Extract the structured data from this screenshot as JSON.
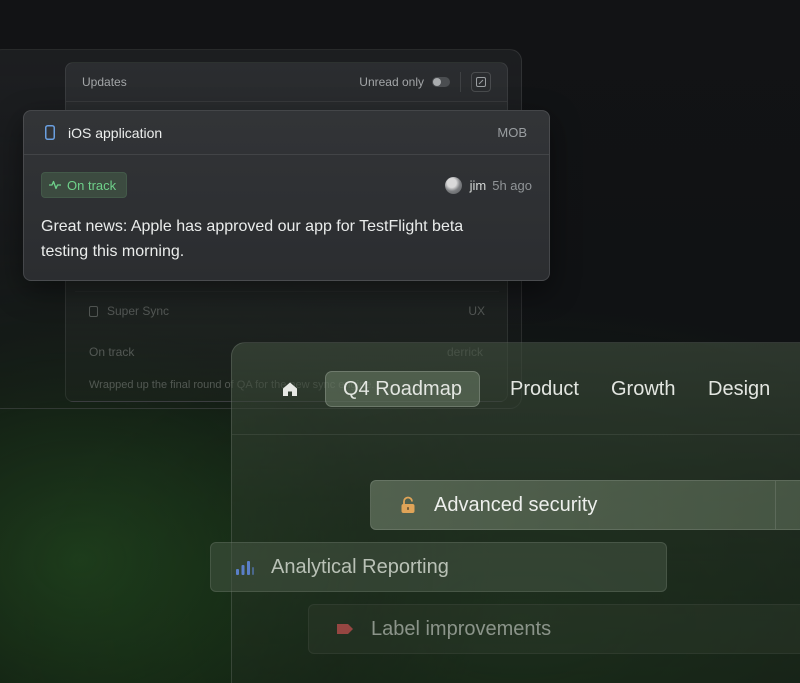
{
  "updates": {
    "title": "Updates",
    "unread_label": "Unread only",
    "unread_only": false
  },
  "sync_card": {
    "title": "Super Sync",
    "code": "UX",
    "status": "On track",
    "author": "derrick",
    "preview": "Wrapped up the final round of QA for the new sync engine."
  },
  "update_card": {
    "project": "iOS application",
    "code": "MOB",
    "status": "On track",
    "author": "jim",
    "time": "5h ago",
    "body": "Great news: Apple has approved our app for TestFlight beta testing this morning."
  },
  "roadmap": {
    "tabs": [
      {
        "label": "Q4 Roadmap",
        "active": true
      },
      {
        "label": "Product",
        "active": false
      },
      {
        "label": "Growth",
        "active": false
      },
      {
        "label": "Design",
        "active": false
      }
    ],
    "features": [
      {
        "label": "Advanced security",
        "icon": "lock-icon"
      },
      {
        "label": "Analytical Reporting",
        "icon": "bar-chart-icon"
      },
      {
        "label": "Label improvements",
        "icon": "label-tag-icon"
      }
    ]
  },
  "colors": {
    "accent_green": "#6ed08a",
    "phone_blue": "#6a9fe0",
    "lock_orange": "#e0a458",
    "chart_blue": "#5a7fc8",
    "tag_red": "#c85050"
  }
}
